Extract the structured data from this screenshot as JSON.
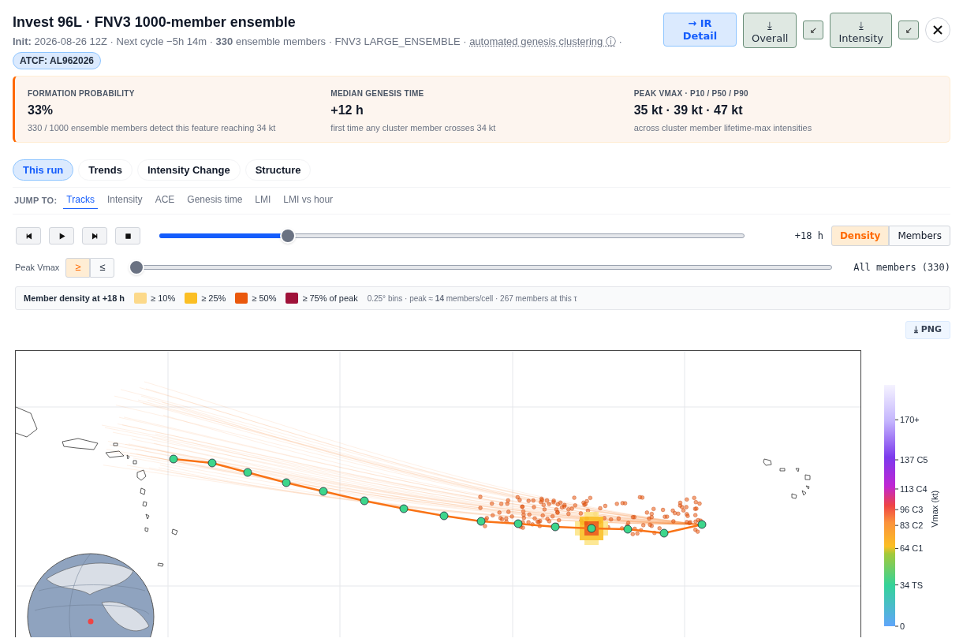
{
  "header": {
    "title": "Invest 96L · FNV3 1000-member ensemble",
    "meta_before": "**Init:** 2026-08-26 12Z · Next cycle −5h 14m · **330** ensemble members · FNV3 LARGE_ENSEMBLE ·",
    "meta_link": "automated genesis clustering ⓘ",
    "meta_after": "·",
    "badge": "ATCF: AL962026"
  },
  "actions": [
    {
      "kind": "link",
      "label": "→ IR Detail"
    },
    {
      "kind": "download",
      "label": "⤓ Overall"
    },
    {
      "kind": "expand"
    },
    {
      "kind": "download",
      "label": "⤓ Intensity"
    },
    {
      "kind": "expand"
    },
    {
      "kind": "close"
    }
  ],
  "stats": [
    {
      "label": "FORMATION PROBABILITY",
      "value": "33%",
      "note": "330 / 1000 ensemble members detect this feature reaching 34 kt"
    },
    {
      "label": "MEDIAN GENESIS TIME",
      "value": "+12 h",
      "note": "first time any cluster member crosses 34 kt"
    },
    {
      "label": "PEAK VMAX · P10 / P50 / P90",
      "value": "35 kt · 39 kt · 47 kt",
      "note": "across cluster member lifetime-max intensities"
    }
  ],
  "tabs": [
    {
      "label": "This run",
      "selected": true
    },
    {
      "label": "Trends",
      "selected": false
    },
    {
      "label": "Intensity Change",
      "selected": false
    },
    {
      "label": "Structure",
      "selected": false
    }
  ],
  "jump": {
    "label": "JUMP TO:",
    "links": [
      {
        "label": "Tracks",
        "selected": true
      },
      {
        "label": "Intensity",
        "selected": false
      },
      {
        "label": "ACE",
        "selected": false
      },
      {
        "label": "Genesis time",
        "selected": false
      },
      {
        "label": "LMI",
        "selected": false
      },
      {
        "label": "LMI vs hour",
        "selected": false
      }
    ]
  },
  "playback": {
    "controls": [
      {
        "kind": "first"
      },
      {
        "kind": "play"
      },
      {
        "kind": "last"
      },
      {
        "kind": "stop"
      }
    ],
    "level": 0.22,
    "reading": "+18 h",
    "views": [
      {
        "label": "Density",
        "selected": true
      },
      {
        "label": "Members",
        "selected": false
      }
    ]
  },
  "filter": {
    "label": "Peak Vmax",
    "ops": [
      {
        "label": "≥",
        "selected": true
      },
      {
        "label": "≤",
        "selected": false
      }
    ],
    "level": 0,
    "reading": "All members (330)"
  },
  "legend": {
    "title": "Member density at +18 h",
    "items": [
      {
        "label": "≥ 10%",
        "color": "#fcd98a"
      },
      {
        "label": "≥ 25%",
        "color": "#fbbf24"
      },
      {
        "label": "≥ 50%",
        "color": "#ea580c"
      },
      {
        "label": "≥ 75% of peak",
        "color": "#9f1239"
      }
    ],
    "note": "0.25° bins · peak ≈ **14** members/cell · 267 members at this τ"
  },
  "export_button": "⤓ PNG",
  "colorbar": {
    "title": "Vmax (kt)",
    "ticks": [
      "170+",
      "137 C5",
      "113 C4",
      "96 C3",
      "83 C2",
      "64 C1",
      "34 TS",
      "0"
    ]
  }
}
